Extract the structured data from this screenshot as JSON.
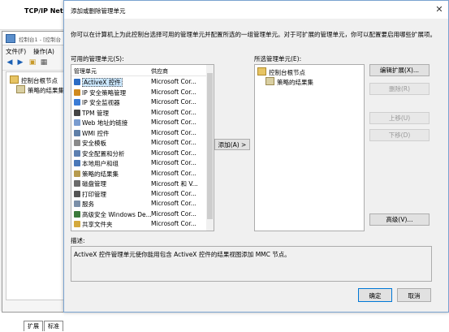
{
  "background": {
    "title": "TCP/IP NetB",
    "subtitle": "",
    "inner_window_title": "控制台1 - [控制台",
    "menu": [
      "文件(F)",
      "操作(A)"
    ],
    "tree": [
      "控制台根节点",
      "策略的结果集"
    ],
    "tabs": [
      "扩展",
      "标准"
    ]
  },
  "dialog": {
    "title": "添加或删除管理单元",
    "description": "你可以在计算机上为此控制台选择可用的管理单元并配置所选的一组管理单元。对于可扩展的管理单元，你可以配置要启用哪些扩展项。",
    "available_label": "可用的管理单元(S):",
    "columns": [
      "管理单元",
      "供应商"
    ],
    "snapins": [
      {
        "name": "ActiveX 控件",
        "vendor": "Microsoft Cor...",
        "icon": "activex-icon",
        "color": "#2b6cc4",
        "selected": true
      },
      {
        "name": "IP 安全策略管理",
        "vendor": "Microsoft Cor...",
        "icon": "ip-security-icon",
        "color": "#d08a1e"
      },
      {
        "name": "IP 安全监视器",
        "vendor": "Microsoft Cor...",
        "icon": "ip-monitor-icon",
        "color": "#3a7bd5"
      },
      {
        "name": "TPM 管理",
        "vendor": "Microsoft Cor...",
        "icon": "tpm-icon",
        "color": "#444444"
      },
      {
        "name": "Web 地址的链接",
        "vendor": "Microsoft Cor...",
        "icon": "web-link-icon",
        "color": "#7a9ccf"
      },
      {
        "name": "WMI 控件",
        "vendor": "Microsoft Cor...",
        "icon": "wmi-icon",
        "color": "#5f7fa8"
      },
      {
        "name": "安全模板",
        "vendor": "Microsoft Cor...",
        "icon": "security-template-icon",
        "color": "#8a8a8a"
      },
      {
        "name": "安全配置和分析",
        "vendor": "Microsoft Cor...",
        "icon": "security-analysis-icon",
        "color": "#5c7fb0"
      },
      {
        "name": "本地用户和组",
        "vendor": "Microsoft Cor...",
        "icon": "users-icon",
        "color": "#4a78b8"
      },
      {
        "name": "策略的结果集",
        "vendor": "Microsoft Cor...",
        "icon": "rsop-icon",
        "color": "#b79b4e"
      },
      {
        "name": "磁盘管理",
        "vendor": "Microsoft 和 V...",
        "icon": "disk-icon",
        "color": "#6b6b6b"
      },
      {
        "name": "打印管理",
        "vendor": "Microsoft Cor...",
        "icon": "printer-icon",
        "color": "#555555"
      },
      {
        "name": "服务",
        "vendor": "Microsoft Cor...",
        "icon": "services-icon",
        "color": "#7b8fa8"
      },
      {
        "name": "高级安全 Windows De...",
        "vendor": "Microsoft Cor...",
        "icon": "firewall-icon",
        "color": "#3b7a3b"
      },
      {
        "name": "共享文件夹",
        "vendor": "Microsoft Cor...",
        "icon": "shared-folder-icon",
        "color": "#d4a93c"
      }
    ],
    "add_button": "添加(A) >",
    "selected_label": "所选管理单元(E):",
    "selected": [
      "控制台根节点",
      "策略的结果集"
    ],
    "buttons": {
      "edit_extensions": "编辑扩展(X)...",
      "remove": "删除(R)",
      "move_up": "上移(U)",
      "move_down": "下移(D)",
      "advanced": "高级(V)..."
    },
    "desc_label": "描述:",
    "desc_text": "ActiveX 控件管理单元使你能用包含 ActiveX 控件的结果视图添加 MMC 节点。",
    "ok": "确定",
    "cancel": "取消"
  }
}
